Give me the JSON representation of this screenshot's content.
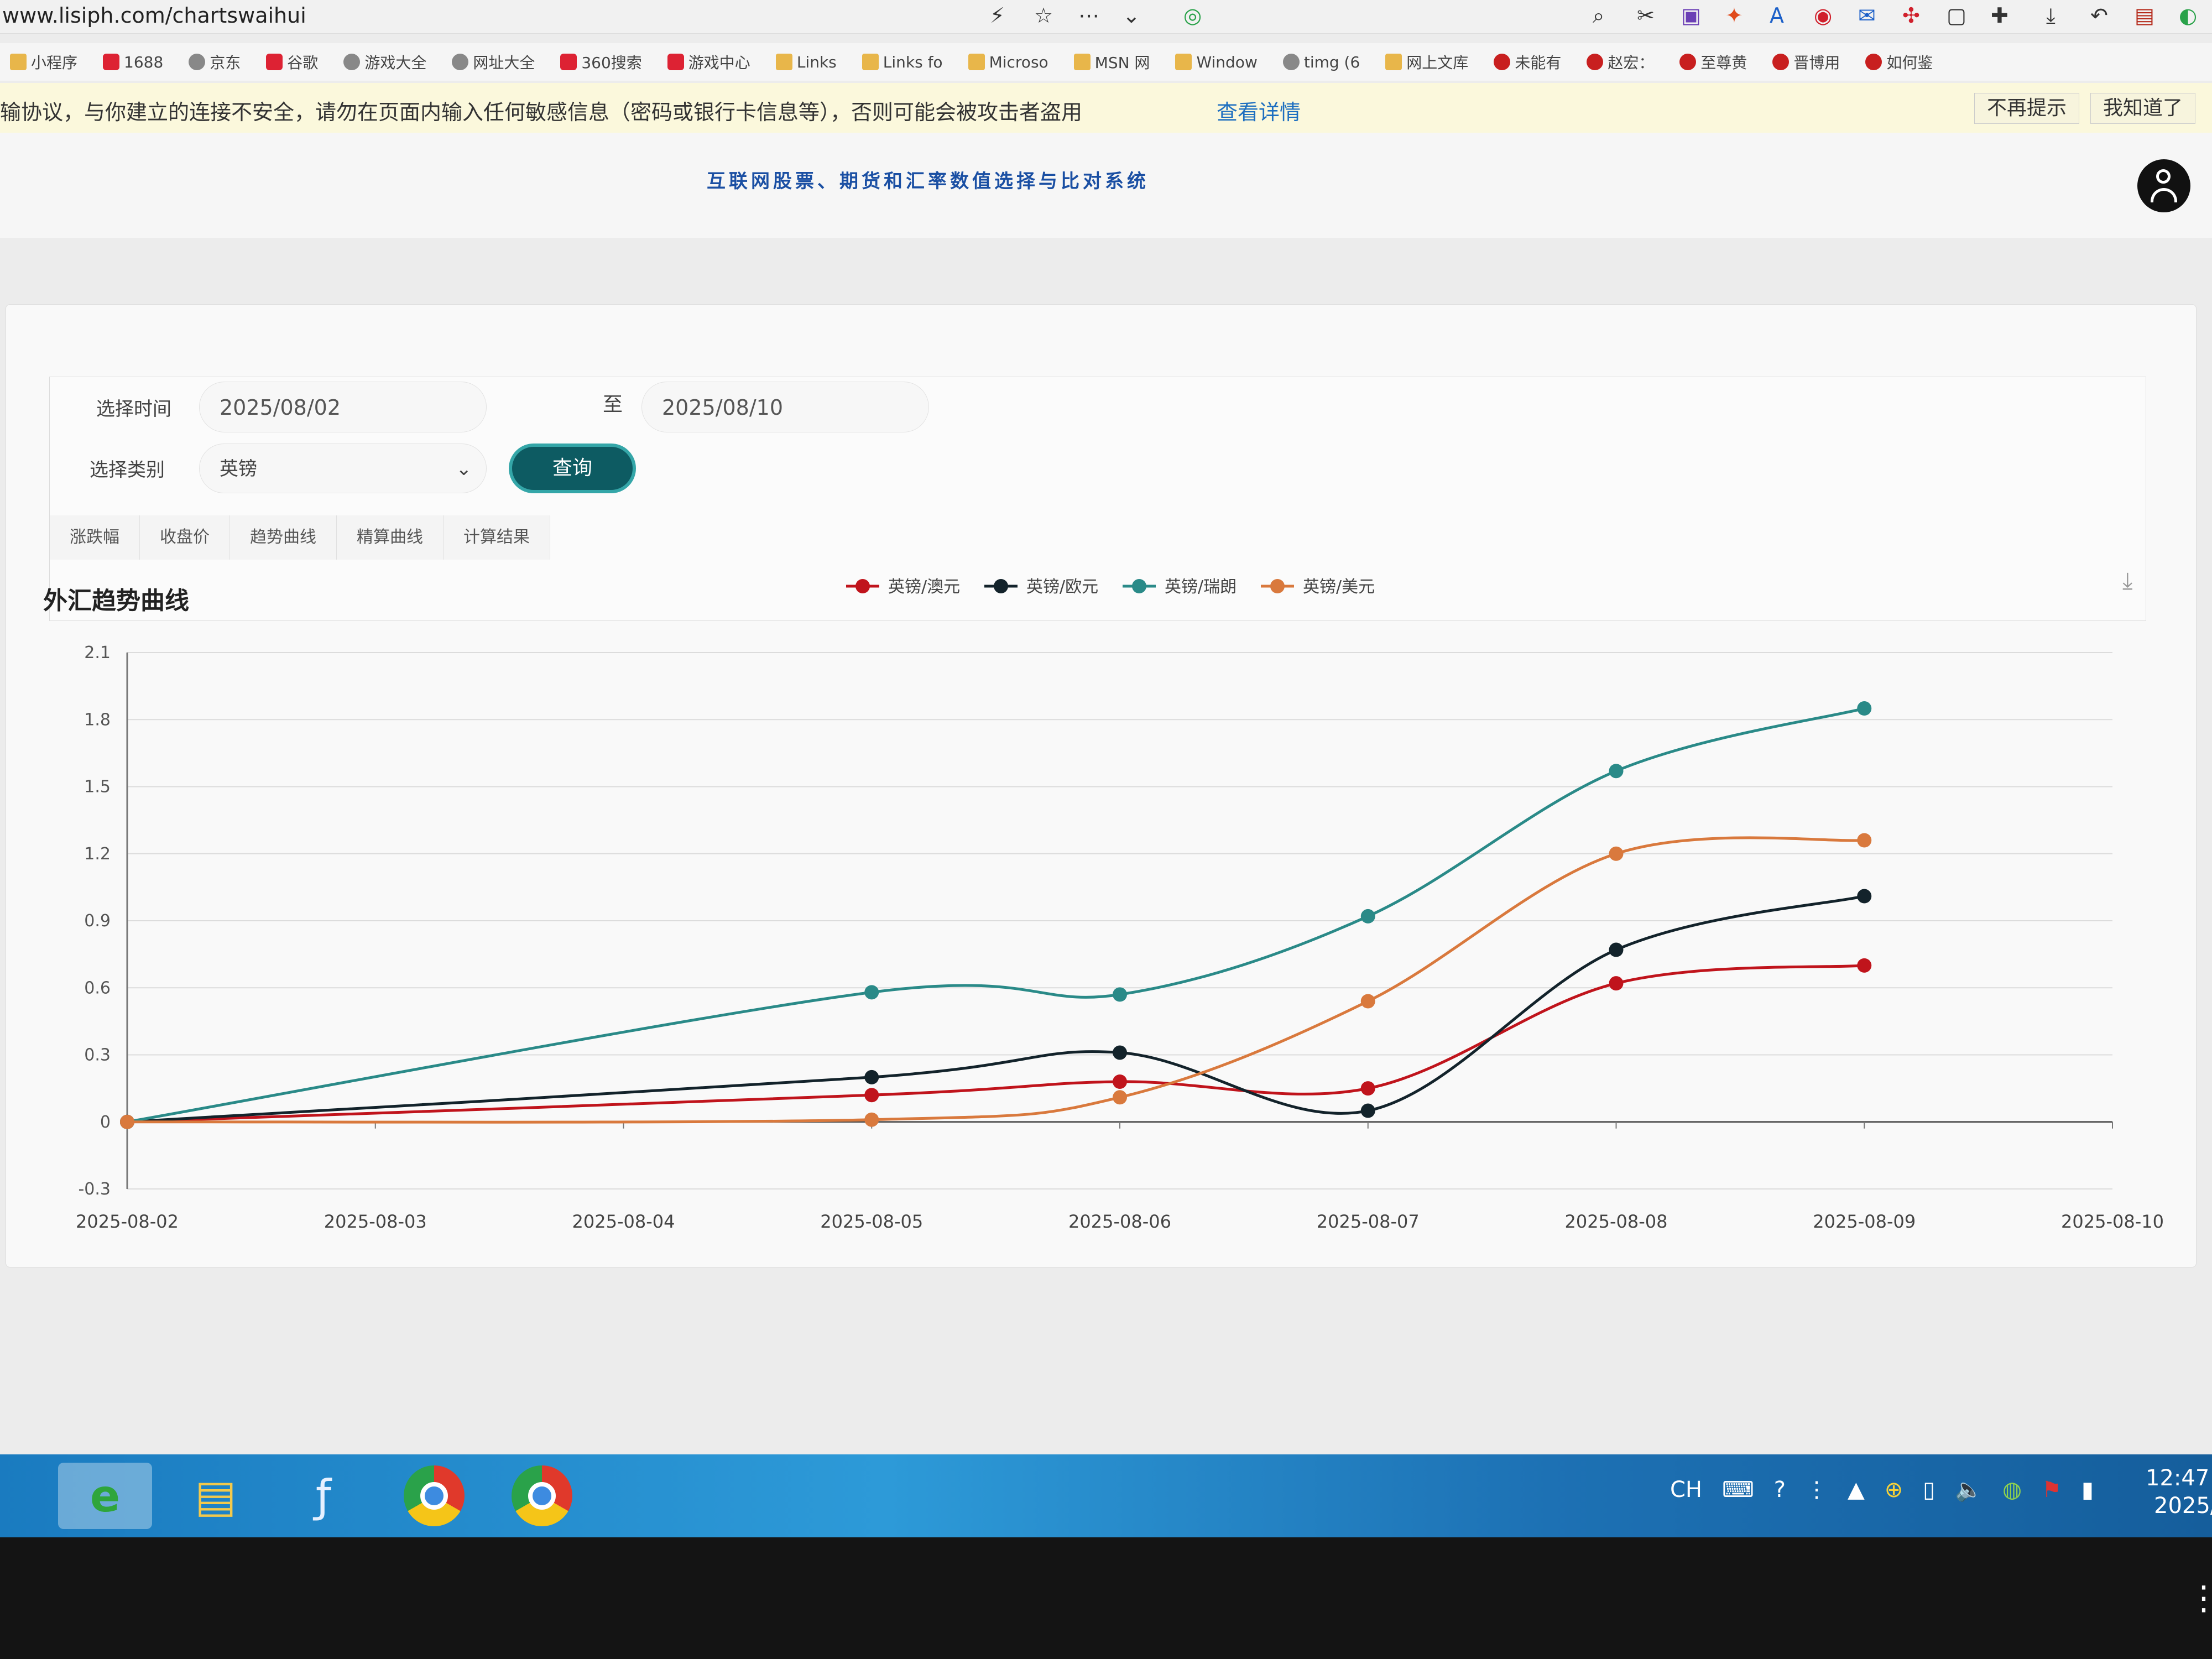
{
  "browser": {
    "url": "www.lisiph.com/chartswaihui",
    "bookmarks": [
      {
        "label": "小程序",
        "icon": "folder-icon"
      },
      {
        "label": "1688",
        "icon": "bookmark-icon"
      },
      {
        "label": "京东",
        "icon": "globe-icon"
      },
      {
        "label": "谷歌",
        "icon": "google-icon"
      },
      {
        "label": "游戏大全",
        "icon": "globe-icon"
      },
      {
        "label": "网址大全",
        "icon": "globe-icon"
      },
      {
        "label": "360搜索",
        "icon": "search-icon"
      },
      {
        "label": "游戏中心",
        "icon": "game-icon"
      },
      {
        "label": "Links",
        "icon": "folder-icon"
      },
      {
        "label": "Links fo",
        "icon": "folder-icon"
      },
      {
        "label": "Microso",
        "icon": "folder-icon"
      },
      {
        "label": "MSN 网",
        "icon": "folder-icon"
      },
      {
        "label": "Window",
        "icon": "folder-icon"
      },
      {
        "label": "timg (6",
        "icon": "globe-icon"
      },
      {
        "label": "网上文库",
        "icon": "folder-icon"
      },
      {
        "label": "未能有",
        "icon": "weibo-icon"
      },
      {
        "label": "赵宏：",
        "icon": "weibo-icon"
      },
      {
        "label": "至尊黄",
        "icon": "weibo-icon"
      },
      {
        "label": "晋博用",
        "icon": "weibo-icon"
      },
      {
        "label": "如何鉴",
        "icon": "weibo-icon"
      }
    ],
    "warning": {
      "text": "输协议，与你建立的连接不安全，请勿在页面内输入任何敏感信息（密码或银行卡信息等），否则可能会被攻击者盗用",
      "link": "查看详情",
      "dismiss_label": "不再提示",
      "ok_label": "我知道了"
    }
  },
  "header": {
    "title": "互联网股票、期货和汇率数值选择与比对系统"
  },
  "filters": {
    "time_label": "选择时间",
    "start_date": "2025/08/02",
    "to_label": "至",
    "end_date": "2025/08/10",
    "category_label": "选择类别",
    "category_value": "英镑",
    "query_label": "查询"
  },
  "tabs": [
    "涨跌幅",
    "收盘价",
    "趋势曲线",
    "精算曲线",
    "计算结果"
  ],
  "chart_title": "外汇趋势曲线",
  "chart_data": {
    "type": "line",
    "title": "外汇趋势曲线",
    "x": [
      "2025-08-02",
      "2025-08-03",
      "2025-08-04",
      "2025-08-05",
      "2025-08-06",
      "2025-08-07",
      "2025-08-08",
      "2025-08-09",
      "2025-08-10"
    ],
    "ylim": [
      -0.3,
      2.1
    ],
    "yticks": [
      -0.3,
      0,
      0.3,
      0.6,
      0.9,
      1.2,
      1.5,
      1.8,
      2.1
    ],
    "legend_position": "top",
    "grid": true,
    "series": [
      {
        "name": "英镑/澳元",
        "color": "#c0141c",
        "points": [
          [
            "2025-08-02",
            0
          ],
          [
            "2025-08-05",
            0.12
          ],
          [
            "2025-08-06",
            0.18
          ],
          [
            "2025-08-07",
            0.15
          ],
          [
            "2025-08-08",
            0.62
          ],
          [
            "2025-08-09",
            0.7
          ]
        ]
      },
      {
        "name": "英镑/欧元",
        "color": "#13232b",
        "points": [
          [
            "2025-08-02",
            0
          ],
          [
            "2025-08-05",
            0.2
          ],
          [
            "2025-08-06",
            0.31
          ],
          [
            "2025-08-07",
            0.05
          ],
          [
            "2025-08-08",
            0.77
          ],
          [
            "2025-08-09",
            1.01
          ]
        ]
      },
      {
        "name": "英镑/瑞朗",
        "color": "#2a8a88",
        "points": [
          [
            "2025-08-02",
            0
          ],
          [
            "2025-08-05",
            0.58
          ],
          [
            "2025-08-06",
            0.57
          ],
          [
            "2025-08-07",
            0.92
          ],
          [
            "2025-08-08",
            1.57
          ],
          [
            "2025-08-09",
            1.85
          ]
        ]
      },
      {
        "name": "英镑/美元",
        "color": "#d9793d",
        "points": [
          [
            "2025-08-02",
            0
          ],
          [
            "2025-08-05",
            0.01
          ],
          [
            "2025-08-06",
            0.11
          ],
          [
            "2025-08-07",
            0.54
          ],
          [
            "2025-08-08",
            1.2
          ],
          [
            "2025-08-09",
            1.26
          ]
        ]
      }
    ]
  },
  "taskbar": {
    "apps": [
      "ie-browser",
      "file-explorer",
      "flash",
      "chrome",
      "chrome"
    ],
    "ime": "CH",
    "time": "12:47",
    "date": "2025/"
  }
}
